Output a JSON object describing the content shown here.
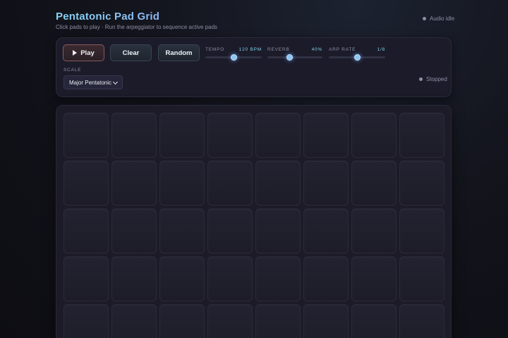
{
  "header": {
    "title": "Pentatonic Pad Grid",
    "subtitle": "Click pads to play · Run the arpeggiator to sequence active pads"
  },
  "audio_status": "Audio idle",
  "controls": {
    "play_label": "Play",
    "clear_label": "Clear",
    "random_label": "Random",
    "tempo": {
      "label": "TEMPO",
      "value": "120 BPM",
      "level": 0.5
    },
    "reverb": {
      "label": "REVERB",
      "value": "40%",
      "level": 0.4
    },
    "arp_rate": {
      "label": "ARP RATE",
      "value": "1/8",
      "level": 0.5
    },
    "scale": {
      "label": "SCALE",
      "selected": "Major Pentatonic"
    },
    "arp_status": "Stopped"
  },
  "grid": {
    "columns": 8,
    "rows": 5,
    "active_pads": []
  },
  "colors": {
    "accent": "#7fd0ea",
    "thumb": "#8fc4f0",
    "play_border": "#8a5a5e"
  }
}
